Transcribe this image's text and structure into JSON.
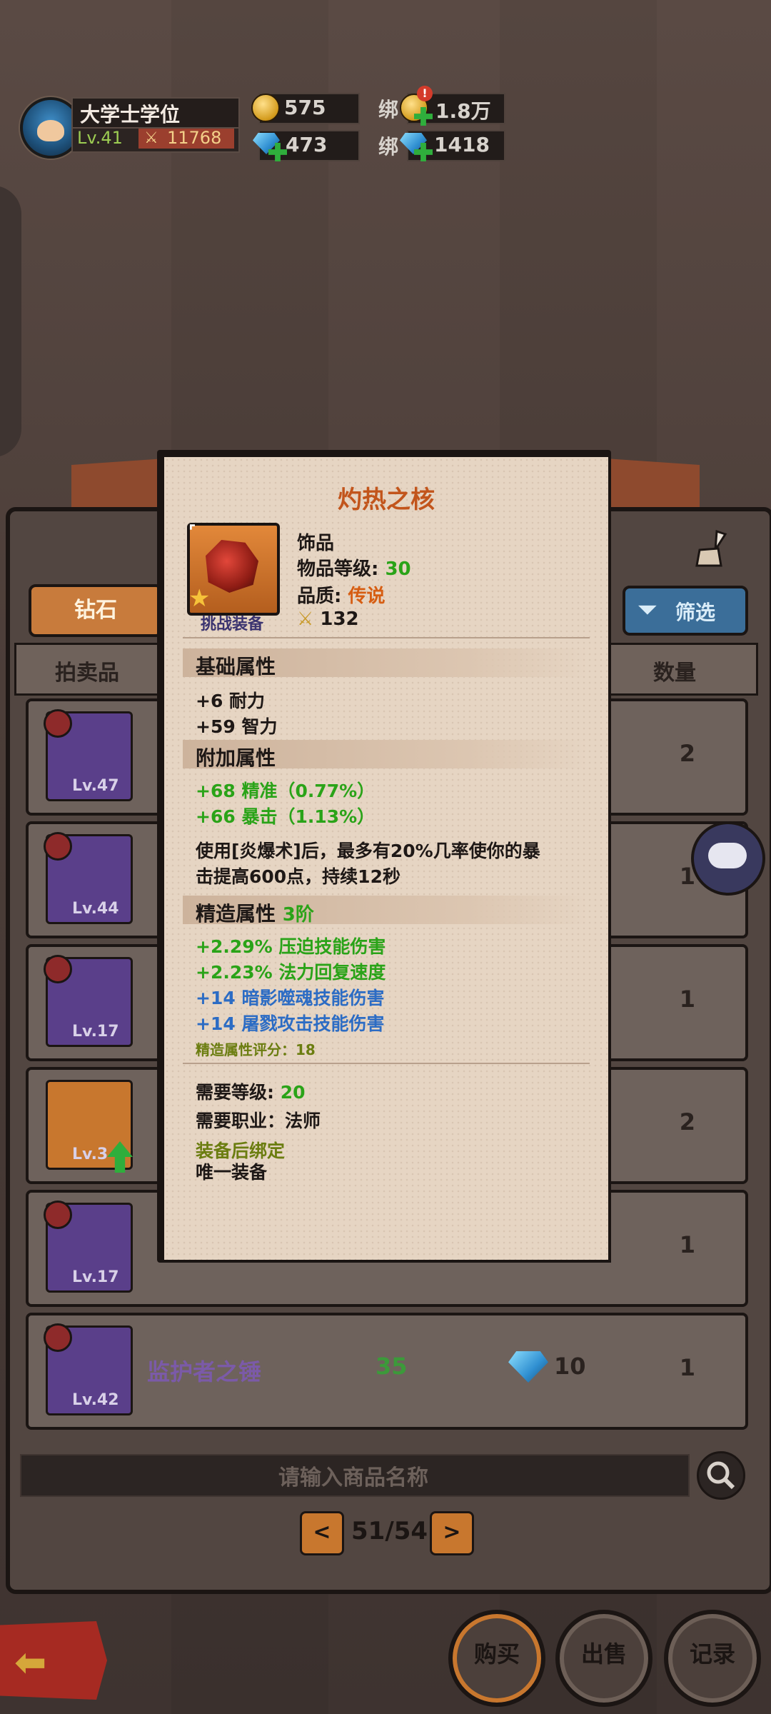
{
  "player": {
    "name": "大学士学位",
    "level": "Lv.41",
    "power": "11768"
  },
  "resources": {
    "gold": "575",
    "bound_label": "绑",
    "bound_gold": "1.8万",
    "bound_gold_alert": "!",
    "diamond": "473",
    "bound_diamond": "1418"
  },
  "market": {
    "tab_diamond": "钻石",
    "filter": "筛选",
    "col_item": "拍卖品",
    "col_qty": "数量",
    "rows": [
      {
        "level": "Lv.47",
        "qty": "2",
        "icon": "hammer-icon"
      },
      {
        "level": "Lv.44",
        "qty": "1",
        "icon": "armor-icon"
      },
      {
        "level": "Lv.17",
        "qty": "1",
        "icon": "shield-icon"
      },
      {
        "level": "Lv.3",
        "qty": "2",
        "icon": "ore-icon"
      },
      {
        "level": "Lv.17",
        "qty": "1",
        "icon": "ring-icon"
      },
      {
        "level": "Lv.42",
        "qty": "1",
        "icon": "mace-icon",
        "name": "监护者之锤",
        "req_level": "35",
        "price": "10"
      }
    ],
    "search_placeholder": "请输入商品名称",
    "pager": {
      "prev": "<",
      "next": ">",
      "text": "51/54"
    }
  },
  "bottom": {
    "buy": "购买",
    "sell": "出售",
    "record": "记录"
  },
  "tooltip": {
    "title": "灼热之核",
    "type": "饰品",
    "item_level_label": "物品等级:",
    "item_level": "30",
    "quality_label": "品质:",
    "quality": "传说",
    "score": "132",
    "tag": "挑战装备",
    "base_title": "基础属性",
    "base": [
      "+6 耐力",
      "+59 智力"
    ],
    "extra_title": "附加属性",
    "extra": [
      "+68 精准（0.77%）",
      "+66 暴击（1.13%）"
    ],
    "effect_line1": "使用[炎爆术]后，最多有20%几率使你的暴",
    "effect_line2": "击提高600点，持续12秒",
    "refine_title": "精造属性",
    "refine_tier": "3阶",
    "refine_green": [
      "+2.29% 压迫技能伤害",
      "+2.23% 法力回复速度"
    ],
    "refine_blue": [
      "+14 暗影噬魂技能伤害",
      "+14 屠戮攻击技能伤害"
    ],
    "refine_score": "精造属性评分：18",
    "req_level_label": "需要等级:",
    "req_level": "20",
    "req_class": "需要职业：法师",
    "bind": "装备后绑定",
    "unique": "唯一装备"
  },
  "colors": {
    "accent_orange": "#c2551c",
    "green_stat": "#2aa318",
    "blue_stat": "#2c6cc4",
    "panel_bg": "#e6d5c3"
  }
}
